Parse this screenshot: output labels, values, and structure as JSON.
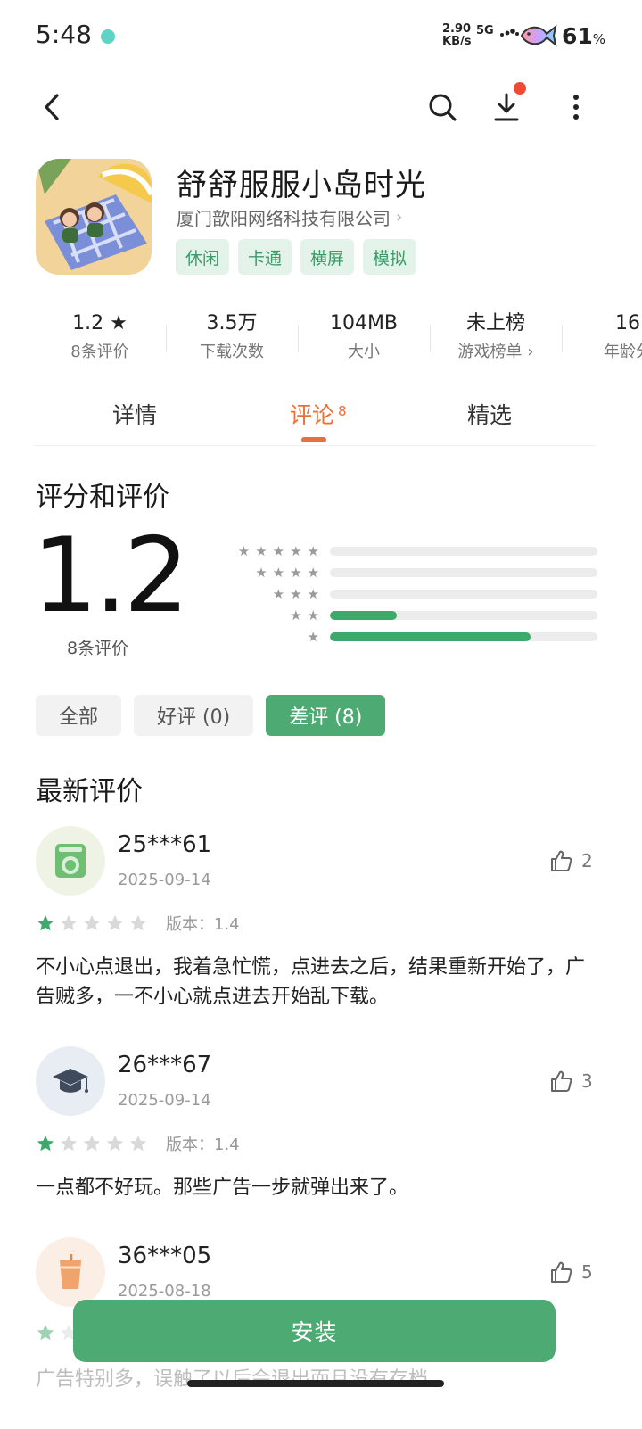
{
  "status": {
    "time": "5:48",
    "speed_top": "2.90",
    "speed_unit": "KB/s",
    "network": "5G",
    "battery": "61",
    "battery_unit": "%"
  },
  "toolbar": {
    "back_icon": "chevron-left-icon",
    "search_icon": "search-icon",
    "download_icon": "download-icon",
    "more_icon": "more-vertical-icon",
    "badge_color": "#ef4a35"
  },
  "app": {
    "title": "舒舒服服小岛时光",
    "developer": "厦门歆阳网络科技有限公司",
    "developer_chevron": "›",
    "tags": [
      "休闲",
      "卡通",
      "横屏",
      "模拟"
    ]
  },
  "stats": [
    {
      "value": "1.2 ★",
      "label": "8条评价"
    },
    {
      "value": "3.5万",
      "label": "下载次数"
    },
    {
      "value": "104MB",
      "label": "大小"
    },
    {
      "value": "未上榜",
      "label": "游戏榜单 ›"
    },
    {
      "value": "16",
      "label": "年龄分"
    }
  ],
  "tabs": {
    "details": "详情",
    "reviews": "评论",
    "reviews_count": "8",
    "picks": "精选"
  },
  "rating": {
    "section_title": "评分和评价",
    "score": "1.2",
    "count_label": "8条评价",
    "distribution": [
      {
        "stars": 5,
        "fraction": 0.0
      },
      {
        "stars": 4,
        "fraction": 0.0
      },
      {
        "stars": 3,
        "fraction": 0.0
      },
      {
        "stars": 2,
        "fraction": 0.25
      },
      {
        "stars": 1,
        "fraction": 0.75
      }
    ],
    "accent": "#3fa96b"
  },
  "filters": {
    "all": "全部",
    "good": "好评 (0)",
    "bad": "差评 (8)"
  },
  "latest_title": "最新评价",
  "reviews": [
    {
      "name": "25***61",
      "date": "2025-09-14",
      "likes": "2",
      "stars": 1,
      "version": "版本：1.4",
      "text": "不小心点退出，我着急忙慌，点进去之后，结果重新开始了，广告贼多，一不小心就点进去开始乱下载。",
      "avatar_icon": "washing-machine-icon"
    },
    {
      "name": "26***67",
      "date": "2025-09-14",
      "likes": "3",
      "stars": 1,
      "version": "版本：1.4",
      "text": "一点都不好玩。那些广告一步就弹出来了。",
      "avatar_icon": "graduation-cap-icon"
    },
    {
      "name": "36***05",
      "date": "2025-08-18",
      "likes": "5",
      "stars": 1,
      "version": "",
      "text": "",
      "avatar_icon": "drink-cup-icon"
    }
  ],
  "cut_text": "广告特别多，误触了以后会退出而且没有存档",
  "install_label": "安装"
}
